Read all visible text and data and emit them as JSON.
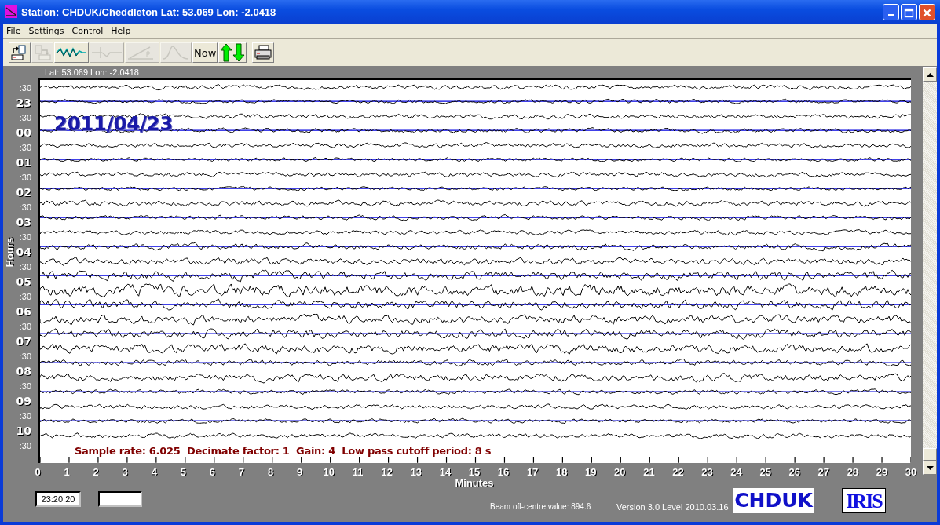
{
  "window": {
    "title": "Station: CHDUK/Cheddleton Lat: 53.069 Lon: -2.0418"
  },
  "menu": [
    "File",
    "Settings",
    "Control",
    "Help"
  ],
  "toolbar": [
    {
      "kind": "open",
      "disabled": false
    },
    {
      "kind": "export",
      "disabled": true
    },
    {
      "kind": "wave",
      "disabled": false
    },
    {
      "kind": "pulse",
      "disabled": true
    },
    {
      "kind": "ramp",
      "disabled": true
    },
    {
      "kind": "peak",
      "disabled": true
    },
    {
      "kind": "text",
      "label": "Now",
      "disabled": false
    },
    {
      "kind": "updown",
      "disabled": false
    },
    {
      "kind": "print",
      "disabled": false
    }
  ],
  "location_label": "Lat: 53.069 Lon: -2.0418",
  "date_overlay": "2011/04/23",
  "y_axis": {
    "title": "Hours",
    "rows": [
      {
        "label": ":30",
        "kind": "half"
      },
      {
        "label": "23",
        "kind": "hour"
      },
      {
        "label": ":30",
        "kind": "half"
      },
      {
        "label": "00",
        "kind": "hour"
      },
      {
        "label": ":30",
        "kind": "half"
      },
      {
        "label": "01",
        "kind": "hour"
      },
      {
        "label": ":30",
        "kind": "half"
      },
      {
        "label": "02",
        "kind": "hour"
      },
      {
        "label": ":30",
        "kind": "half"
      },
      {
        "label": "03",
        "kind": "hour"
      },
      {
        "label": ":30",
        "kind": "half"
      },
      {
        "label": "04",
        "kind": "hour"
      },
      {
        "label": ":30",
        "kind": "half"
      },
      {
        "label": "05",
        "kind": "hour"
      },
      {
        "label": ":30",
        "kind": "half"
      },
      {
        "label": "06",
        "kind": "hour"
      },
      {
        "label": ":30",
        "kind": "half"
      },
      {
        "label": "07",
        "kind": "hour"
      },
      {
        "label": ":30",
        "kind": "half"
      },
      {
        "label": "08",
        "kind": "hour"
      },
      {
        "label": ":30",
        "kind": "half"
      },
      {
        "label": "09",
        "kind": "hour"
      },
      {
        "label": ":30",
        "kind": "half"
      },
      {
        "label": "10",
        "kind": "hour"
      },
      {
        "label": ":30",
        "kind": "half"
      }
    ]
  },
  "settings_line": "Sample rate: 6.025  Decimate factor: 1  Gain: 4  Low pass cutoff period: 8 s",
  "x_axis": {
    "title": "Minutes",
    "labels": [
      "0",
      "1",
      "2",
      "3",
      "4",
      "5",
      "6",
      "7",
      "8",
      "9",
      "10",
      "11",
      "12",
      "13",
      "14",
      "15",
      "16",
      "17",
      "18",
      "19",
      "20",
      "21",
      "22",
      "23",
      "24",
      "25",
      "26",
      "27",
      "28",
      "29",
      "30"
    ]
  },
  "status": {
    "time": "23:20:20",
    "beam": "Beam off-centre value: 894.6",
    "version": "Version 3.0 Level 2010.03.16",
    "station_logo": "CHDUK",
    "network_logo": "IRIS"
  }
}
